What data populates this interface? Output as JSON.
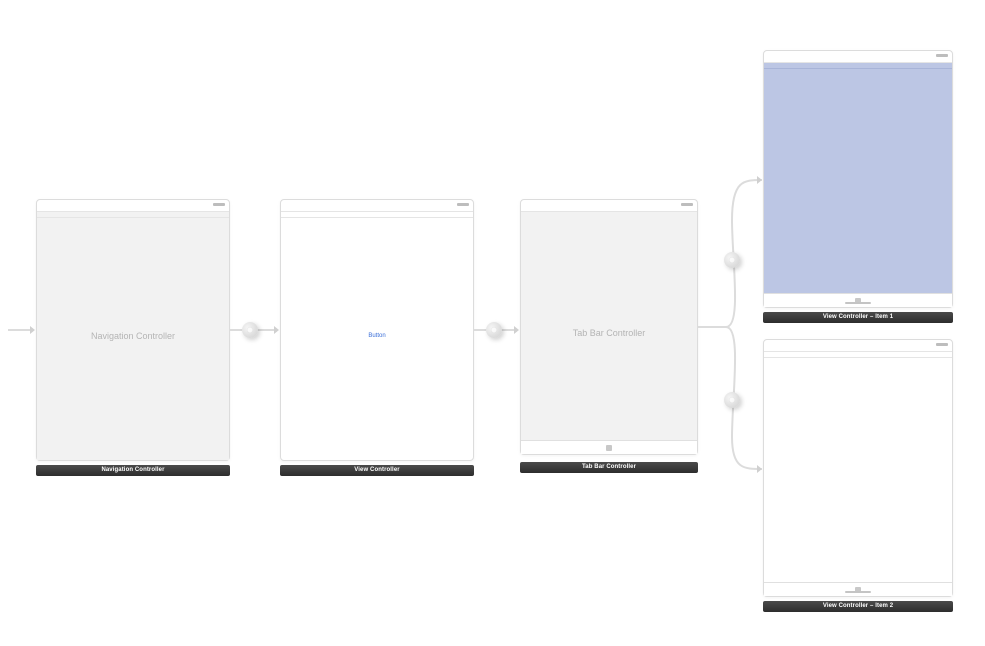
{
  "scenes": {
    "nav": {
      "title": "Navigation Controller",
      "caption": "Navigation Controller"
    },
    "root": {
      "button_label": "Button",
      "caption": "View Controller"
    },
    "tabbar": {
      "title": "Tab Bar Controller",
      "caption": "Tab Bar Controller"
    },
    "item1": {
      "caption": "View Controller – Item 1"
    },
    "item2": {
      "caption": "View Controller – Item 2"
    }
  },
  "segues": {
    "entry": "initial",
    "nav_to_root": "root view controller",
    "root_to_tab": "show",
    "tab_to_item1": "view controllers",
    "tab_to_item2": "view controllers"
  }
}
